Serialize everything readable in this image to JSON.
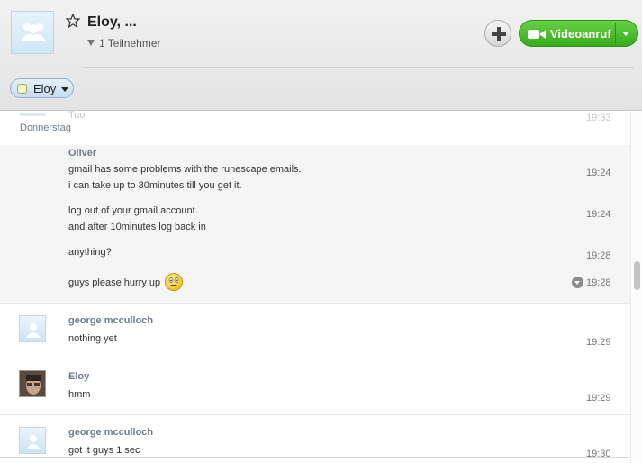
{
  "header": {
    "title": "Eloy, ...",
    "participants": "1 Teilnehmer",
    "video_label": "Videoanruf",
    "chip_name": "Eloy",
    "icons": [
      "group-avatar-icon",
      "star-icon",
      "add-icon",
      "video-camera-icon",
      "chevron-down-icon"
    ]
  },
  "conversation": {
    "ghost_sender": "Tuo",
    "ghost_time": "19:33",
    "date_separator": "Donnerstag",
    "oliver": {
      "sender": "Oliver",
      "m1_line1": "gmail has some problems with the runescape emails.",
      "m1_line2": "i can take up to 30minutes till you get it.",
      "m1_time": "19:24",
      "m2_line1": "log out of your gmail account.",
      "m2_line2": "and after 10minutes log back in",
      "m2_time": "19:24",
      "m3": "anything?",
      "m3_time": "19:28",
      "m4": "guys please hurry up",
      "m4_time": "19:28"
    },
    "george1": {
      "sender": "george mcculloch",
      "text": "nothing yet",
      "time": "19:29"
    },
    "eloy": {
      "sender": "Eloy",
      "text": "hmm",
      "time": "19:29"
    },
    "george2": {
      "sender": "george mcculloch",
      "text": "got it guys 1 sec",
      "time": "19:30"
    }
  },
  "colors": {
    "accent_green": "#3aaa1e",
    "sender_color": "#6c7a8c",
    "chip_blue": "#c9dcf3"
  }
}
